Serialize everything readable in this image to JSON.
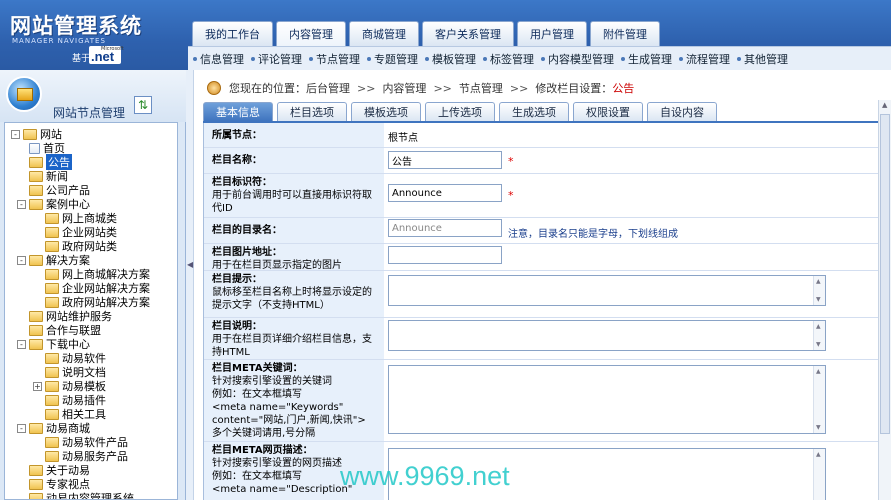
{
  "logo": {
    "title": "网站管理系统",
    "subtitle": "MANAGER NAVIGATES",
    "based_on": "基于",
    "ms_label": "Microsoft",
    "net_label": ".net"
  },
  "main_tabs": [
    "我的工作台",
    "内容管理",
    "商城管理",
    "客户关系管理",
    "用户管理",
    "附件管理"
  ],
  "main_tab_active": "内容管理",
  "sub_nav": [
    "信息管理",
    "评论管理",
    "节点管理",
    "专题管理",
    "模板管理",
    "标签管理",
    "内容模型管理",
    "生成管理",
    "流程管理",
    "其他管理"
  ],
  "sidebar": {
    "title": "网站节点管理"
  },
  "tree": [
    {
      "label": "网站"
    },
    {
      "label": "首页"
    },
    {
      "label": "公告"
    },
    {
      "label": "新闻"
    },
    {
      "label": "公司产品"
    },
    {
      "label": "案例中心"
    },
    {
      "label": "网上商城类"
    },
    {
      "label": "企业网站类"
    },
    {
      "label": "政府网站类"
    },
    {
      "label": "解决方案"
    },
    {
      "label": "网上商城解决方案"
    },
    {
      "label": "企业网站解决方案"
    },
    {
      "label": "政府网站解决方案"
    },
    {
      "label": "网站维护服务"
    },
    {
      "label": "合作与联盟"
    },
    {
      "label": "下载中心"
    },
    {
      "label": "动易软件"
    },
    {
      "label": "说明文档"
    },
    {
      "label": "动易模板"
    },
    {
      "label": "动易插件"
    },
    {
      "label": "相关工具"
    },
    {
      "label": "动易商城"
    },
    {
      "label": "动易软件产品"
    },
    {
      "label": "动易服务产品"
    },
    {
      "label": "关于动易"
    },
    {
      "label": "专家视点"
    },
    {
      "label": "动易内容管理系统"
    }
  ],
  "breadcrumb": {
    "prefix": "您现在的位置：",
    "items": [
      "后台管理",
      "内容管理",
      "节点管理",
      "修改栏目设置："
    ],
    "current": "公告",
    "sep": ">>"
  },
  "tabs": [
    "基本信息",
    "栏目选项",
    "模板选项",
    "上传选项",
    "生成选项",
    "权限设置",
    "自设内容"
  ],
  "tab_active": "基本信息",
  "form": {
    "parent": {
      "label": "所属节点：",
      "value": "根节点"
    },
    "name": {
      "label": "栏目名称：",
      "value": "公告",
      "required": "*"
    },
    "identifier": {
      "label": "栏目标识符：",
      "desc": "用于前台调用时可以直接用标识符取代ID",
      "value": "Announce",
      "required": "*"
    },
    "dir": {
      "label": "栏目的目录名：",
      "value": "Announce",
      "note": "注意，目录名只能是字母，下划线组成"
    },
    "image": {
      "label": "栏目图片地址：",
      "desc": "用于在栏目页显示指定的图片",
      "value": ""
    },
    "tips": {
      "label": "栏目提示：",
      "desc": "鼠标移至栏目名称上时将显示设定的提示文字（不支持HTML）"
    },
    "intro": {
      "label": "栏目说明：",
      "desc": "用于在栏目页详细介绍栏目信息，支持HTML"
    },
    "keywords": {
      "label": "栏目META关键词：",
      "desc1": "针对搜索引擎设置的关键词",
      "desc2": "例如：在文本框填写",
      "desc3": "<meta name=\"Keywords\"",
      "desc4": "content=\"网站,门户,新闻,快讯\">",
      "desc5": "多个关键词请用,号分隔"
    },
    "description": {
      "label": "栏目META网页描述：",
      "desc1": "针对搜索引擎设置的网页描述",
      "desc2": "例如：在文本框填写",
      "desc3": "<meta name=\"Description\""
    }
  },
  "watermark": "www.9969.net"
}
